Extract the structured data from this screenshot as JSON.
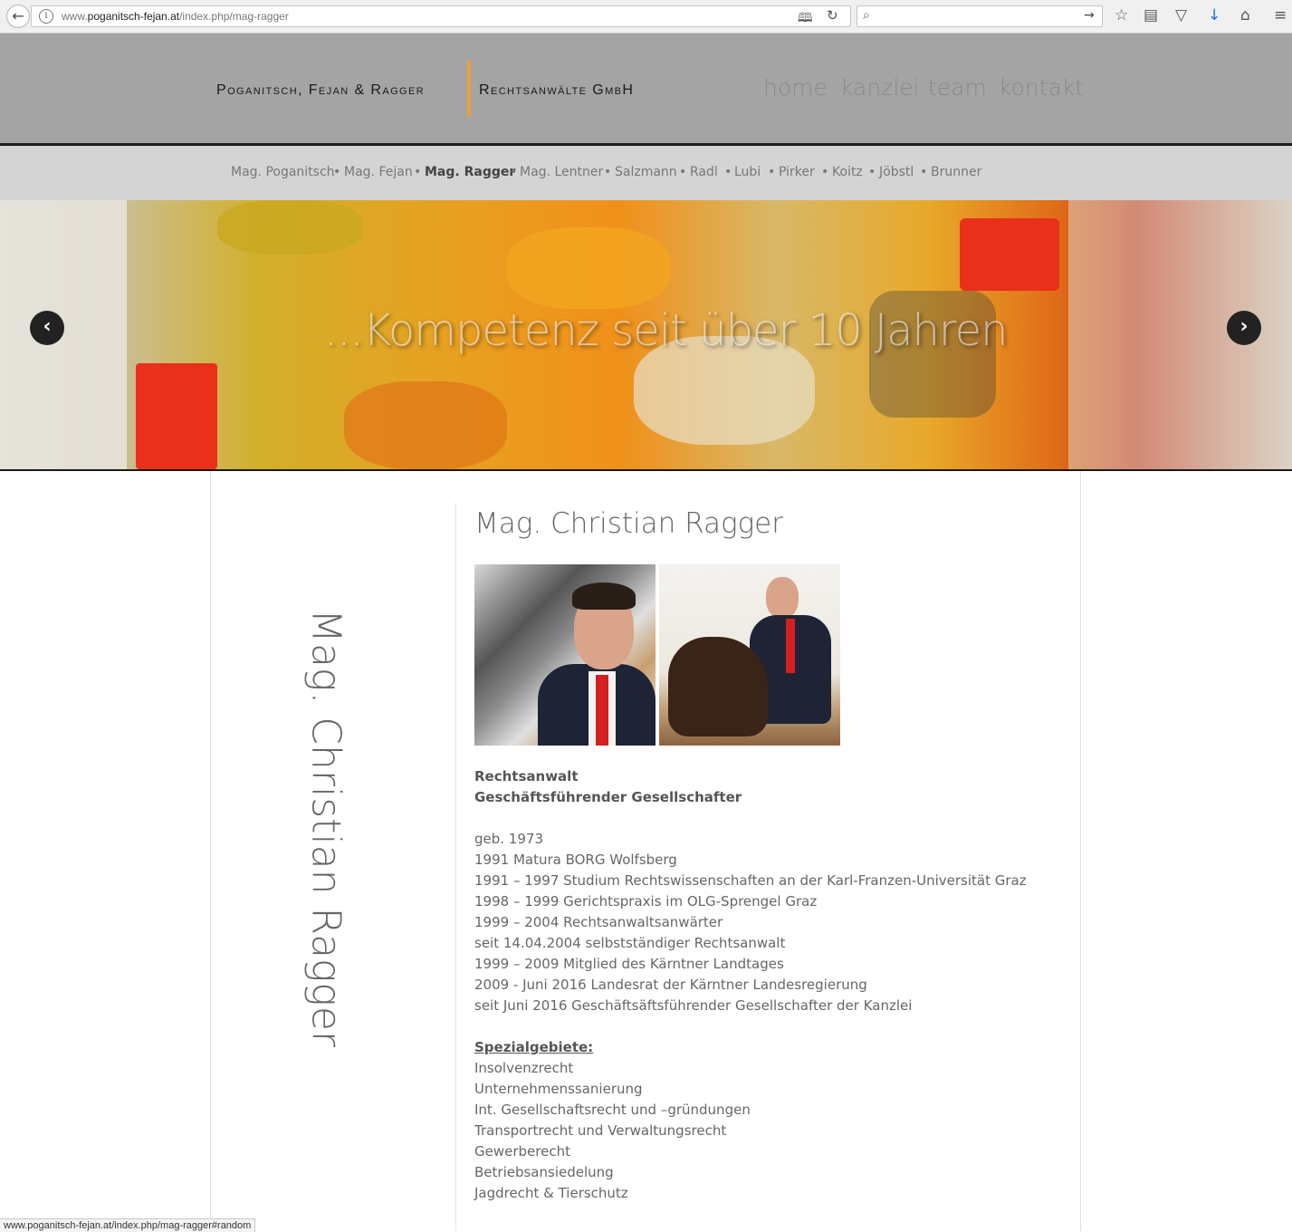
{
  "browser": {
    "url_prefix": "www.",
    "url_domain": "poganitsch-fejan.at",
    "url_path": "/index.php/mag-ragger",
    "status_url": "www.poganitsch-fejan.at/index.php/mag-ragger#random",
    "icons": {
      "back": "back-arrow-icon",
      "info": "info-icon",
      "reader": "reader-view-icon",
      "reload": "reload-icon",
      "search": "search-icon",
      "go": "go-arrow-icon",
      "bookmark": "star-icon",
      "library": "library-icon",
      "pocket": "pocket-icon",
      "download": "download-icon",
      "home": "home-icon",
      "menu": "hamburger-menu-icon"
    }
  },
  "header": {
    "brand_left": "Poganitsch, Fejan & Ragger",
    "brand_right": "Rechtsanwälte GmbH",
    "accent_color": "#e9a03a",
    "nav": [
      "home",
      "kanzlei",
      "team",
      "kontakt"
    ]
  },
  "subnav": {
    "items": [
      "Mag. Poganitsch",
      "Mag. Fejan",
      "Mag. Ragger",
      "Mag. Lentner",
      "Salzmann",
      "Radl",
      "Lubi",
      "Pirker",
      "Koitz",
      "Jöbstl",
      "Brunner"
    ],
    "active": "Mag. Ragger",
    "separator": "•"
  },
  "banner": {
    "caption": "...Kompetenz seit über 10 Jahren",
    "prev_symbol": "‹",
    "next_symbol": "›"
  },
  "profile": {
    "vertical_name": "Mag. Christian Ragger",
    "title": "Mag. Christian Ragger",
    "roles": [
      "Rechtsanwalt",
      "Geschäftsführender Gesellschafter"
    ],
    "cv": [
      "geb. 1973",
      "1991 Matura BORG Wolfsberg",
      "1991 – 1997 Studium Rechtswissenschaften an der Karl-Franzen-Universität Graz",
      "1998 – 1999 Gerichtspraxis im OLG-Sprengel Graz",
      "1999 – 2004 Rechtsanwaltsanwärter",
      "seit 14.04.2004 selbstständiger Rechtsanwalt",
      "1999 – 2009 Mitglied des Kärntner Landtages",
      "2009 - Juni 2016 Landesrat der Kärntner Landesregierung",
      "seit Juni 2016 Geschäftsäftsführender Gesellschafter der Kanzlei"
    ],
    "special_heading": "Spezialgebiete:",
    "specialties": [
      "Insolvenzrecht",
      "Unternehmenssanierung",
      "Int. Gesellschaftsrecht und –gründungen",
      "Transportrecht und Verwaltungsrecht",
      "Gewerberecht",
      "Betriebsansiedelung",
      "Jagdrecht & Tierschutz"
    ]
  }
}
